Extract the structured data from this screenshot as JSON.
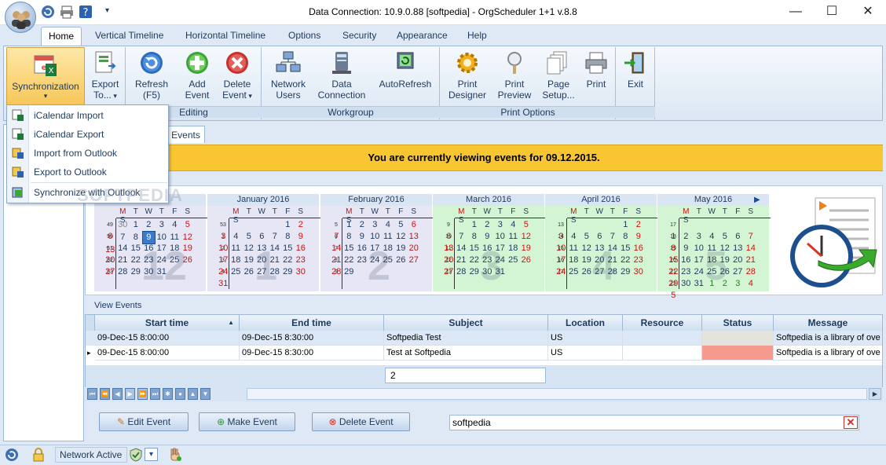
{
  "window": {
    "title": "Data Connection: 10.9.0.88 [softpedia] - OrgScheduler 1+1 v.8.8",
    "minimize": "—",
    "maximize": "☐",
    "close": "✕"
  },
  "tabs": [
    "Home",
    "Vertical Timeline",
    "Horizontal Timeline",
    "Options",
    "Security",
    "Appearance",
    "Help"
  ],
  "ribbon": {
    "sync": {
      "label": "Synchronization"
    },
    "export": {
      "label1": "Export",
      "label2": "To..."
    },
    "refresh": {
      "label1": "Refresh",
      "label2": "(F5)"
    },
    "add": {
      "label1": "Add",
      "label2": "Event"
    },
    "delete": {
      "label1": "Delete",
      "label2": "Event"
    },
    "network": {
      "label1": "Network",
      "label2": "Users"
    },
    "dataconn": {
      "label1": "Data",
      "label2": "Connection"
    },
    "autorefresh": {
      "label1": "AutoRefresh"
    },
    "printdesigner": {
      "label1": "Print",
      "label2": "Designer"
    },
    "printpreview": {
      "label1": "Print",
      "label2": "Preview"
    },
    "pagesetup": {
      "label1": "Page",
      "label2": "Setup..."
    },
    "print": {
      "label1": "Print"
    },
    "exit": {
      "label1": "Exit"
    },
    "groups": {
      "editing": "Editing",
      "workgroup": "Workgroup",
      "printoptions": "Print Options"
    }
  },
  "dropdown": [
    "iCalendar Import",
    "iCalendar Export",
    "Import from Outlook",
    "Export to Outlook",
    "Synchronize with Outlook"
  ],
  "events_tab": "Events",
  "banner": "You are currently viewing events for 09.12.2015.",
  "calendar": {
    "weekdays": [
      "M",
      "T",
      "W",
      "T",
      "F",
      "S",
      "S"
    ],
    "months": [
      {
        "name": "15",
        "bg": "#e6e6f5",
        "big": "12",
        "weeks": [
          [
            "49",
            "30",
            "1",
            "2",
            "3",
            "4",
            "5",
            "6"
          ],
          [
            "50",
            "7",
            "8",
            "9",
            "10",
            "11",
            "12",
            "13"
          ],
          [
            "51",
            "14",
            "15",
            "16",
            "17",
            "18",
            "19",
            "20"
          ],
          [
            "52",
            "21",
            "22",
            "23",
            "24",
            "25",
            "26",
            "27"
          ],
          [
            "53",
            "28",
            "29",
            "30",
            "31",
            "",
            "",
            ""
          ]
        ]
      },
      {
        "name": "January 2016",
        "bg": "#e6e6f5",
        "big": "1",
        "weeks": [
          [
            "53",
            "",
            "",
            "",
            "",
            "1",
            "2",
            "3"
          ],
          [
            "1",
            "4",
            "5",
            "6",
            "7",
            "8",
            "9",
            "10"
          ],
          [
            "2",
            "11",
            "12",
            "13",
            "14",
            "15",
            "16",
            "17"
          ],
          [
            "3",
            "18",
            "19",
            "20",
            "21",
            "22",
            "23",
            "24"
          ],
          [
            "4",
            "25",
            "26",
            "27",
            "28",
            "29",
            "30",
            "31"
          ]
        ]
      },
      {
        "name": "February 2016",
        "bg": "#e6e6f5",
        "big": "2",
        "weeks": [
          [
            "5",
            "1",
            "2",
            "3",
            "4",
            "5",
            "6",
            "7"
          ],
          [
            "6",
            "8",
            "9",
            "10",
            "11",
            "12",
            "13",
            "14"
          ],
          [
            "7",
            "15",
            "16",
            "17",
            "18",
            "19",
            "20",
            "21"
          ],
          [
            "8",
            "22",
            "23",
            "24",
            "25",
            "26",
            "27",
            "28"
          ],
          [
            "9",
            "29",
            "",
            "",
            "",
            "",
            "",
            ""
          ]
        ]
      },
      {
        "name": "March 2016",
        "bg": "#d4f5d4",
        "big": "3",
        "weeks": [
          [
            "9",
            "",
            "1",
            "2",
            "3",
            "4",
            "5",
            "6"
          ],
          [
            "10",
            "7",
            "8",
            "9",
            "10",
            "11",
            "12",
            "13"
          ],
          [
            "11",
            "14",
            "15",
            "16",
            "17",
            "18",
            "19",
            "20"
          ],
          [
            "12",
            "21",
            "22",
            "23",
            "24",
            "25",
            "26",
            "27"
          ],
          [
            "13",
            "28",
            "29",
            "30",
            "31",
            "",
            "",
            ""
          ]
        ]
      },
      {
        "name": "April 2016",
        "bg": "#d4f5d4",
        "big": "4",
        "weeks": [
          [
            "13",
            "",
            "",
            "",
            "",
            "1",
            "2",
            "3"
          ],
          [
            "14",
            "4",
            "5",
            "6",
            "7",
            "8",
            "9",
            "10"
          ],
          [
            "15",
            "11",
            "12",
            "13",
            "14",
            "15",
            "16",
            "17"
          ],
          [
            "16",
            "18",
            "19",
            "20",
            "21",
            "22",
            "23",
            "24"
          ],
          [
            "17",
            "25",
            "26",
            "27",
            "28",
            "29",
            "30",
            ""
          ]
        ]
      },
      {
        "name": "May 2016",
        "bg": "#d4f5d4",
        "big": "5",
        "weeks": [
          [
            "17",
            "",
            "",
            "",
            "",
            "",
            "",
            "1"
          ],
          [
            "18",
            "2",
            "3",
            "4",
            "5",
            "6",
            "7",
            "8"
          ],
          [
            "19",
            "9",
            "10",
            "11",
            "12",
            "13",
            "14",
            "15"
          ],
          [
            "20",
            "16",
            "17",
            "18",
            "19",
            "20",
            "21",
            "22"
          ],
          [
            "21",
            "23",
            "24",
            "25",
            "26",
            "27",
            "28",
            "29"
          ],
          [
            "22",
            "30",
            "31",
            "1",
            "2",
            "3",
            "4",
            "5"
          ]
        ]
      }
    ]
  },
  "view_events": {
    "title": "View Events",
    "columns": [
      "Start time",
      "End time",
      "Subject",
      "Location",
      "Resource",
      "Status",
      "Message"
    ],
    "rows": [
      [
        "09-Dec-15 8:00:00",
        "09-Dec-15 8:30:00",
        "Softpedia Test",
        "US",
        "",
        "",
        "Softpedia is a library of ove"
      ],
      [
        "09-Dec-15 8:00:00",
        "09-Dec-15 8:30:00",
        "Test at Softpedia",
        "US",
        "",
        "",
        "Softpedia is a library of ove"
      ]
    ],
    "count": "2",
    "status_colors": [
      "#e4e4dc",
      "#f59a8c"
    ]
  },
  "buttons": {
    "edit": "Edit Event",
    "make": "Make Event",
    "delete": "Delete Event"
  },
  "search": {
    "value": "softpedia"
  },
  "statusbar": {
    "network": "Network Active"
  },
  "watermark": "SOFTPEDIA"
}
